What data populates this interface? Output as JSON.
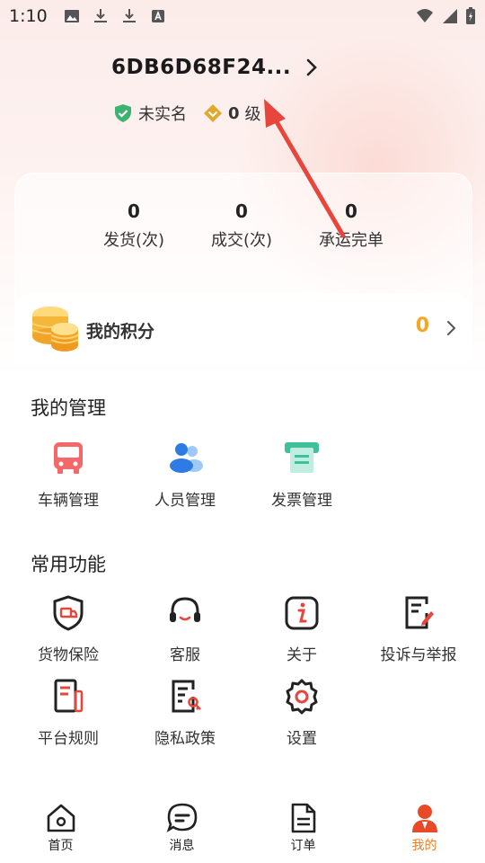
{
  "status_bar": {
    "time": "1:10"
  },
  "profile": {
    "username": "6DB6D68F24..."
  },
  "badges": {
    "verify_label": "未实名",
    "level_num": "0",
    "level_unit": "级"
  },
  "stats": [
    {
      "value": "0",
      "label": "发货(次)"
    },
    {
      "value": "0",
      "label": "成交(次)"
    },
    {
      "value": "0",
      "label": "承运完单"
    }
  ],
  "points": {
    "label": "我的积分",
    "value": "0"
  },
  "management": {
    "title": "我的管理",
    "items": [
      {
        "label": "车辆管理",
        "icon": "truck-icon"
      },
      {
        "label": "人员管理",
        "icon": "people-icon"
      },
      {
        "label": "发票管理",
        "icon": "invoice-icon"
      }
    ]
  },
  "functions": {
    "title": "常用功能",
    "items": [
      {
        "label": "货物保险",
        "icon": "shield-truck-icon"
      },
      {
        "label": "客服",
        "icon": "headset-icon"
      },
      {
        "label": "关于",
        "icon": "info-icon"
      },
      {
        "label": "投诉与举报",
        "icon": "report-icon"
      },
      {
        "label": "平台规则",
        "icon": "rules-icon"
      },
      {
        "label": "隐私政策",
        "icon": "privacy-icon"
      },
      {
        "label": "设置",
        "icon": "gear-icon"
      }
    ]
  },
  "bottom_nav": {
    "items": [
      {
        "label": "首页",
        "icon": "home-icon"
      },
      {
        "label": "消息",
        "icon": "message-icon"
      },
      {
        "label": "订单",
        "icon": "order-icon"
      },
      {
        "label": "我的",
        "icon": "user-icon"
      }
    ],
    "active": "我的"
  },
  "colors": {
    "accent": "#f27b1c",
    "points": "#f5a623",
    "verify_green": "#3cb371",
    "level_gold": "#e0a82e",
    "annotation_red": "#e8453c"
  }
}
